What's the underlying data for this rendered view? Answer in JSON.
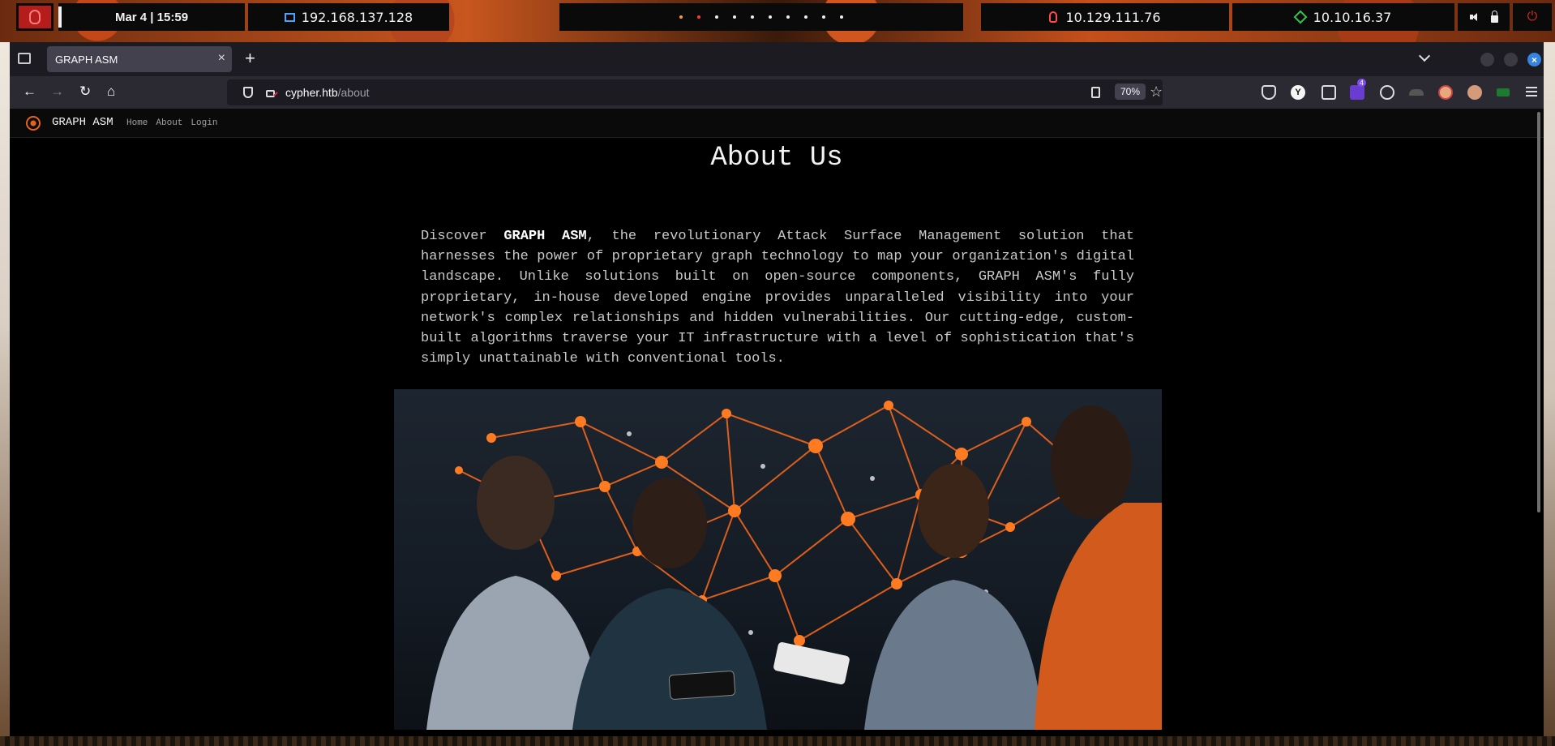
{
  "panel": {
    "clock": "Mar 4 | 15:59",
    "vm_ip": "192.168.137.128",
    "target_ip": "10.129.111.76",
    "vpn_ip": "10.10.16.37"
  },
  "browser": {
    "tab_title": "GRAPH ASM",
    "url_host": "cypher.htb",
    "url_path": "/about",
    "zoom": "70%",
    "extension_badge": "4"
  },
  "site": {
    "brand": "GRAPH ASM",
    "nav": [
      "Home",
      "About",
      "Login"
    ],
    "title": "About Us",
    "intro_prefix": "Discover ",
    "intro_brand": "GRAPH ASM",
    "intro_rest": ", the revolutionary Attack Surface Management solution that harnesses the power of proprietary graph technology to map your organization's digital landscape. Unlike solutions built on open-source components, GRAPH ASM's fully proprietary, in-house developed engine provides unparalleled visibility into your network's complex relationships and hidden vulnerabilities. Our cutting-edge, custom-built algorithms traverse your IT infrastructure with a level of sophistication that's simply unattainable with conventional tools."
  },
  "colors": {
    "accent": "#e2641e",
    "page_bg": "#000000",
    "tab_active": "#42414d",
    "urlbar_bg": "#1c1b22"
  }
}
